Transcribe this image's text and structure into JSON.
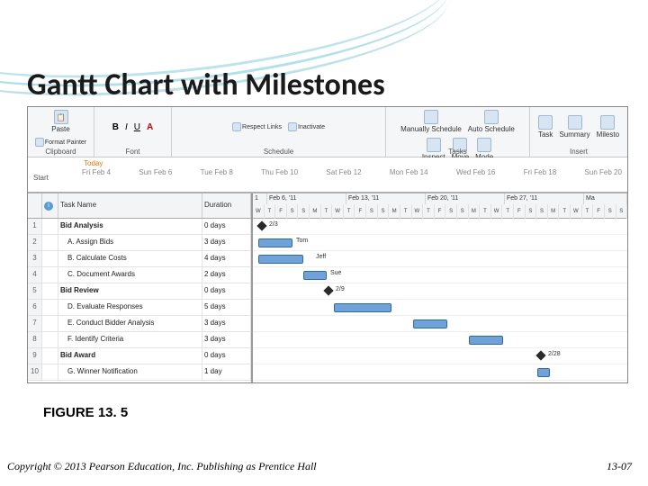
{
  "slide": {
    "title": "Gantt Chart with Milestones",
    "figure_label": "FIGURE 13. 5",
    "copyright": "Copyright © 2013 Pearson Education, Inc. Publishing as Prentice Hall",
    "page_number": "13-07"
  },
  "ribbon": {
    "paste": "Paste",
    "format_painter": "Format Painter",
    "clipboard": "Clipboard",
    "font": "Font",
    "schedule": "Schedule",
    "tasks": "Tasks",
    "insert": "Insert",
    "bold": "B",
    "italic": "I",
    "underline": "U",
    "respect_links": "Respect Links",
    "inactivate": "Inactivate",
    "manually_schedule": "Manually Schedule",
    "auto_schedule": "Auto Schedule",
    "inspect": "Inspect",
    "move": "Move",
    "mode": "Mode",
    "task": "Task",
    "summary": "Summary",
    "milestone": "Milesto"
  },
  "timeline": {
    "today": "Today",
    "start": "Start",
    "dates": [
      "Fri Feb 4",
      "Sun Feb 6",
      "Tue Feb 8",
      "Thu Feb 10",
      "Sat Feb 12",
      "Mon Feb 14",
      "Wed Feb 16",
      "Fri Feb 18",
      "Sun Feb 20"
    ]
  },
  "columns": {
    "info": "",
    "task_name": "Task Name",
    "duration": "Duration",
    "week1": "1",
    "week2": "Feb 6, '11",
    "week3": "Feb 13, '11",
    "week4": "Feb 20, '11",
    "week5": "Feb 27, '11",
    "week6": "Ma",
    "days": [
      "W",
      "T",
      "F",
      "S",
      "S",
      "M",
      "T",
      "W",
      "T",
      "F",
      "S",
      "S",
      "M",
      "T",
      "W",
      "T",
      "F",
      "S",
      "S",
      "M",
      "T",
      "W",
      "T",
      "F",
      "S",
      "S",
      "M",
      "T",
      "W",
      "T",
      "F",
      "S",
      "S"
    ]
  },
  "tasks": [
    {
      "id": "1",
      "name": "Bid Analysis",
      "duration": "0 days",
      "summary": true
    },
    {
      "id": "2",
      "name": "A. Assign Bids",
      "duration": "3 days"
    },
    {
      "id": "3",
      "name": "B. Calculate Costs",
      "duration": "4 days"
    },
    {
      "id": "4",
      "name": "C. Document Awards",
      "duration": "2 days"
    },
    {
      "id": "5",
      "name": "Bid Review",
      "duration": "0 days",
      "summary": true
    },
    {
      "id": "6",
      "name": "D. Evaluate Responses",
      "duration": "5 days"
    },
    {
      "id": "7",
      "name": "E. Conduct Bidder Analysis",
      "duration": "3 days"
    },
    {
      "id": "8",
      "name": "F. Identify Criteria",
      "duration": "3 days"
    },
    {
      "id": "9",
      "name": "Bid Award",
      "duration": "0 days",
      "summary": true
    },
    {
      "id": "10",
      "name": "G. Winner Notification",
      "duration": "1 day"
    }
  ],
  "bar_labels": {
    "r1": "2/3",
    "r2": "Tom",
    "r3": "Jeff",
    "r4": "Sue",
    "r5": "2/9",
    "r9": "2/28"
  },
  "chart_data": {
    "type": "gantt",
    "title": "Gantt Chart with Milestones",
    "x_axis": {
      "unit": "days",
      "start": "2011-02-02",
      "end": "2011-03-06",
      "week_labels": [
        "Feb 6, '11",
        "Feb 13, '11",
        "Feb 20, '11",
        "Feb 27, '11"
      ]
    },
    "tasks": [
      {
        "id": 1,
        "name": "Bid Analysis",
        "type": "milestone",
        "date": "2011-02-03",
        "label": "2/3"
      },
      {
        "id": 2,
        "name": "A. Assign Bids",
        "type": "task",
        "start": "2011-02-03",
        "duration_days": 3,
        "resource": "Tom"
      },
      {
        "id": 3,
        "name": "B. Calculate Costs",
        "type": "task",
        "start": "2011-02-03",
        "duration_days": 4,
        "resource": "Jeff"
      },
      {
        "id": 4,
        "name": "C. Document Awards",
        "type": "task",
        "start": "2011-02-08",
        "duration_days": 2,
        "resource": "Sue"
      },
      {
        "id": 5,
        "name": "Bid Review",
        "type": "milestone",
        "date": "2011-02-09",
        "label": "2/9"
      },
      {
        "id": 6,
        "name": "D. Evaluate Responses",
        "type": "task",
        "start": "2011-02-10",
        "duration_days": 5
      },
      {
        "id": 7,
        "name": "E. Conduct Bidder Analysis",
        "type": "task",
        "start": "2011-02-17",
        "duration_days": 3
      },
      {
        "id": 8,
        "name": "F. Identify Criteria",
        "type": "task",
        "start": "2011-02-22",
        "duration_days": 3
      },
      {
        "id": 9,
        "name": "Bid Award",
        "type": "milestone",
        "date": "2011-02-28",
        "label": "2/28"
      },
      {
        "id": 10,
        "name": "G. Winner Notification",
        "type": "task",
        "start": "2011-02-28",
        "duration_days": 1
      }
    ]
  }
}
